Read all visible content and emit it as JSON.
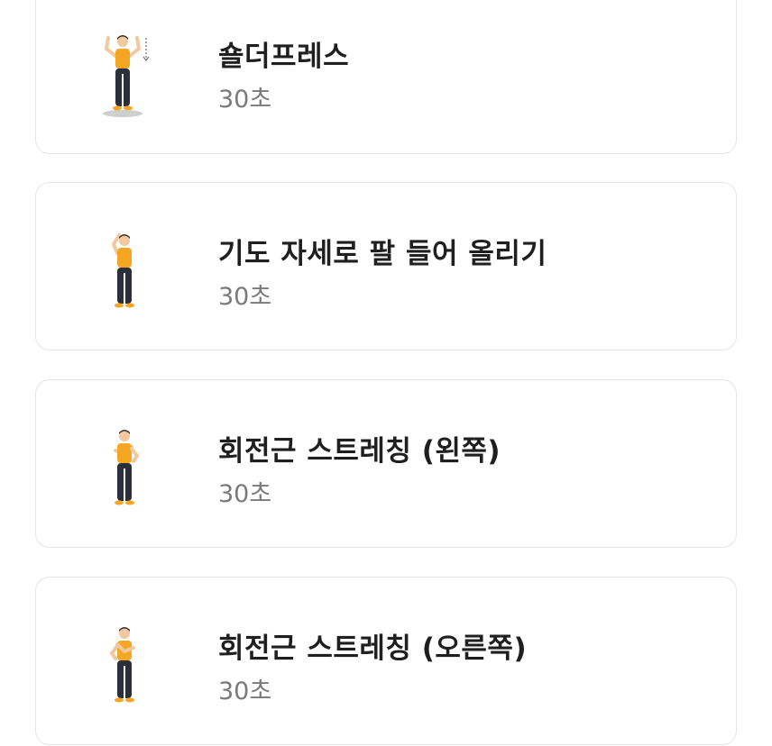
{
  "exercises": [
    {
      "title": "숄더프레스",
      "duration": "30초",
      "figure_icon": "shoulder-press-figure"
    },
    {
      "title": "기도 자세로 팔 들어 올리기",
      "duration": "30초",
      "figure_icon": "prayer-arm-raise-figure"
    },
    {
      "title": "회전근 스트레칭 (왼쪽)",
      "duration": "30초",
      "figure_icon": "rotator-stretch-left-figure"
    },
    {
      "title": "회전근 스트레칭 (오른쪽)",
      "duration": "30초",
      "figure_icon": "rotator-stretch-right-figure"
    }
  ],
  "colors": {
    "shirt": "#f5a623",
    "pants": "#2b2f3a",
    "skin": "#f2c8a0",
    "hair": "#3a2a22",
    "title_text": "#1f1f1f",
    "duration_text": "#7a7a7a",
    "card_border": "#e6e6e6"
  }
}
